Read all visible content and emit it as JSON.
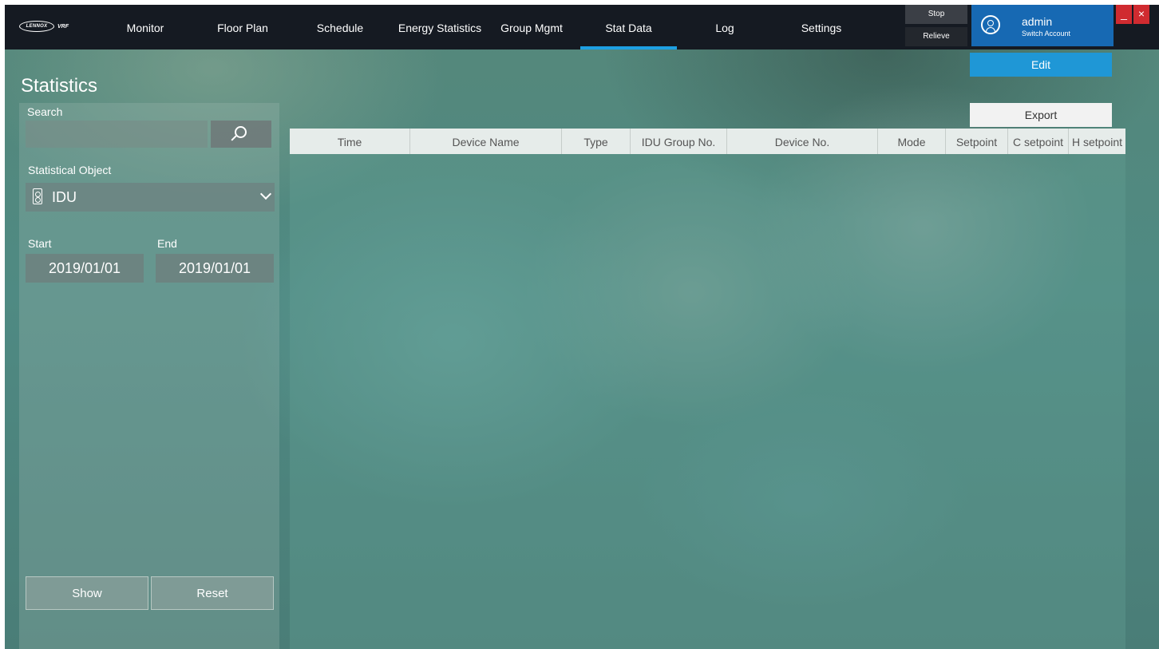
{
  "brand": {
    "logo_text": "LENNOX",
    "logo_suffix": "VRF"
  },
  "nav": {
    "tabs": [
      {
        "label": "Monitor"
      },
      {
        "label": "Floor Plan"
      },
      {
        "label": "Schedule"
      },
      {
        "label": "Energy Statistics"
      },
      {
        "label": "Group Mgmt"
      },
      {
        "label": "Stat Data",
        "active": true
      },
      {
        "label": "Log"
      },
      {
        "label": "Settings"
      }
    ],
    "stop_label": "Stop",
    "relieve_label": "Relieve",
    "minimize_glyph": "_",
    "close_glyph": "×"
  },
  "user": {
    "name": "admin",
    "switch_label": "Switch Account",
    "icon": "user-icon"
  },
  "page": {
    "title": "Statistics",
    "edit_label": "Edit",
    "export_label": "Export"
  },
  "filters": {
    "search_label": "Search",
    "search_value": "",
    "search_icon": "search-icon",
    "object_label": "Statistical Object",
    "object_value": "IDU",
    "object_icon": "idu-icon",
    "start_label": "Start",
    "end_label": "End",
    "start_value": "2019/01/01",
    "end_value": "2019/01/01",
    "show_label": "Show",
    "reset_label": "Reset"
  },
  "table": {
    "columns": [
      "Time",
      "Device Name",
      "Type",
      "IDU Group No.",
      "Device No.",
      "Mode",
      "Setpoint",
      "C setpoint",
      "H setpoint"
    ],
    "rows": []
  },
  "colors": {
    "accent": "#1ea0e3",
    "nav_bg": "#151a22",
    "user_bg": "#1769b3",
    "close_red": "#d02b30"
  }
}
